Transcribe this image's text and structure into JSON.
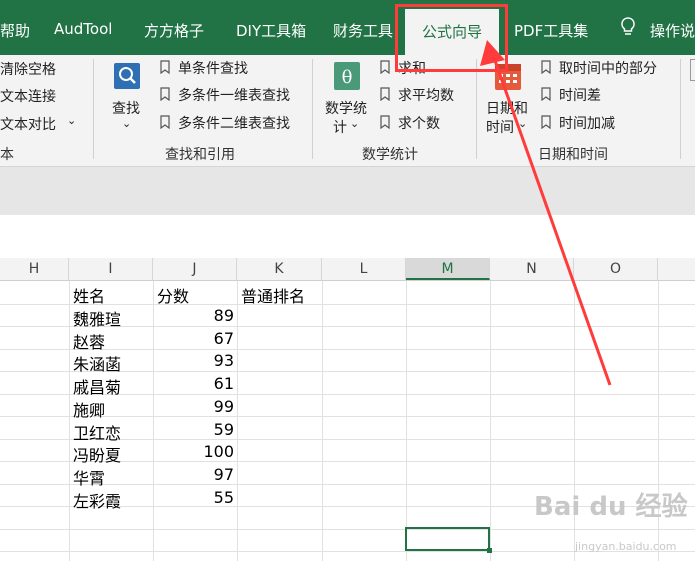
{
  "tabs": [
    {
      "label": "帮助",
      "active": false
    },
    {
      "label": "AudTool",
      "active": false
    },
    {
      "label": "方方格子",
      "active": false
    },
    {
      "label": "DIY工具箱",
      "active": false
    },
    {
      "label": "财务工具",
      "active": false
    },
    {
      "label": "公式向导",
      "active": true
    },
    {
      "label": "PDF工具集",
      "active": false
    }
  ],
  "tell_me": "操作说",
  "ribbon": {
    "text_group": {
      "items": [
        "清除空格",
        "文本连接",
        "文本对比"
      ],
      "label": "本"
    },
    "lookup_group": {
      "big_button": "查找",
      "items": [
        "单条件查找",
        "多条件一维表查找",
        "多条件二维表查找"
      ],
      "label": "查找和引用"
    },
    "math_group": {
      "big_button": [
        "数学统",
        "计"
      ],
      "items": [
        "求和",
        "求平均数",
        "求个数"
      ],
      "label": "数学统计"
    },
    "datetime_group": {
      "big_button": [
        "日期和",
        "时间"
      ],
      "items": [
        "取时间中的部分",
        "时间差",
        "时间加减"
      ],
      "label": "日期和时间"
    }
  },
  "columns": [
    "H",
    "I",
    "J",
    "K",
    "L",
    "M",
    "N",
    "O"
  ],
  "selected_column": "M",
  "table": {
    "headers": [
      "姓名",
      "分数",
      "普通排名"
    ],
    "rows": [
      {
        "name": "魏雅瑄",
        "score": 89
      },
      {
        "name": "赵蓉",
        "score": 67
      },
      {
        "name": "朱涵菡",
        "score": 93
      },
      {
        "name": "戚昌菊",
        "score": 61
      },
      {
        "name": "施卿",
        "score": 99
      },
      {
        "name": "卫红恋",
        "score": 59
      },
      {
        "name": "冯盼夏",
        "score": 100
      },
      {
        "name": "华霄",
        "score": 97
      },
      {
        "name": "左彩霞",
        "score": 55
      }
    ]
  },
  "watermark": {
    "main": "Bai du 经验",
    "sub": "jingyan.baidu.com"
  },
  "colors": {
    "accent": "#217346",
    "highlight": "#ff3b3b"
  }
}
